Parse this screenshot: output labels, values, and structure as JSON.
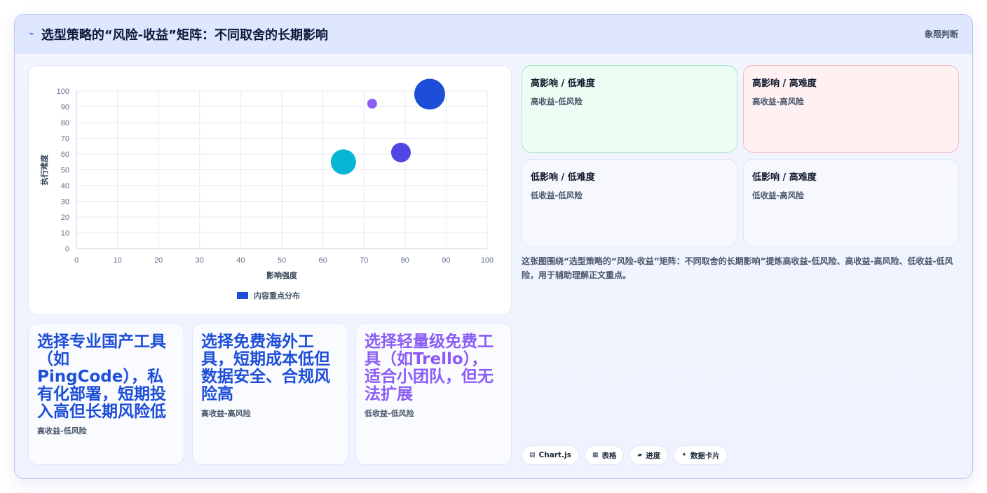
{
  "header": {
    "title": "选型策略的“风险-收益”矩阵：不同取舍的长期影响",
    "tag": "象限判断",
    "icon": "bolt-icon"
  },
  "chart_data": {
    "type": "bubble",
    "xlabel": "影响强度",
    "ylabel": "执行难度",
    "xlim": [
      0,
      100
    ],
    "ylim": [
      0,
      100
    ],
    "xticks": [
      0,
      10,
      20,
      30,
      40,
      50,
      60,
      70,
      80,
      90,
      100
    ],
    "yticks": [
      0,
      10,
      20,
      30,
      40,
      50,
      60,
      70,
      80,
      90,
      100
    ],
    "grid": true,
    "legend_position": "bottom",
    "series": [
      {
        "name": "内容重点分布",
        "color": "#1d4ed8",
        "points": [
          {
            "x": 86,
            "y": 98,
            "r": 22,
            "color": "#1d4ed8"
          },
          {
            "x": 72,
            "y": 92,
            "r": 7,
            "color": "#8b5cf6"
          },
          {
            "x": 79,
            "y": 61,
            "r": 14,
            "color": "#4f46e5"
          },
          {
            "x": 65,
            "y": 55,
            "r": 18,
            "color": "#06b6d4"
          }
        ]
      }
    ]
  },
  "quadrants": [
    {
      "title": "高影响 / 低难度",
      "sub": "高收益-低风险"
    },
    {
      "title": "高影响 / 高难度",
      "sub": "高收益-高风险"
    },
    {
      "title": "低影响 / 低难度",
      "sub": "低收益-低风险"
    },
    {
      "title": "低影响 / 高难度",
      "sub": "低收益-高风险"
    }
  ],
  "description": "这张图围绕“选型策略的“风险-收益”矩阵：不同取舍的长期影响”提炼高收益-低风险、高收益-高风险、低收益-低风险，用于辅助理解正文重点。",
  "cards": [
    {
      "title": "选择专业国产工具（如PingCode），私有化部署，短期投入高但长期风险低",
      "sub": "高收益-低风险"
    },
    {
      "title": "选择免费海外工具，短期成本低但数据安全、合规风险高",
      "sub": "高收益-高风险"
    },
    {
      "title": "选择轻量级免费工具（如Trello），适合小团队，但无法扩展",
      "sub": "低收益-低风险"
    }
  ],
  "chips": [
    {
      "icon": "chart-icon",
      "glyph": "▤",
      "label": "Chart.js"
    },
    {
      "icon": "table-icon",
      "glyph": "▦",
      "label": "表格"
    },
    {
      "icon": "progress-icon",
      "glyph": "▰",
      "label": "进度"
    },
    {
      "icon": "sparkle-icon",
      "glyph": "✦",
      "label": "数据卡片"
    }
  ]
}
